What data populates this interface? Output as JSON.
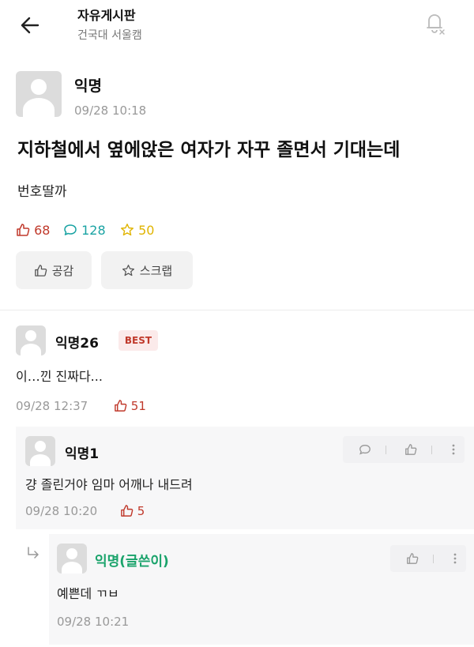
{
  "header": {
    "title": "자유게시판",
    "subtitle": "건국대 서울캠"
  },
  "post": {
    "author": "익명",
    "time": "09/28 10:18",
    "title": "지하철에서 옆에앉은 여자가 자꾸 졸면서 기대는데",
    "body": "번호딸까",
    "likes": "68",
    "comments": "128",
    "scraps": "50",
    "empathy_label": "공감",
    "scrap_label": "스크랩"
  },
  "comments": [
    {
      "author": "익명26",
      "badge": "BEST",
      "text": "이…낀 진짜다...",
      "time": "09/28 12:37",
      "likes": "51"
    },
    {
      "author": "익명1",
      "text": "걍 졸린거야 임마 어깨나 내드려",
      "time": "09/28 10:20",
      "likes": "5"
    },
    {
      "author": "익명(글쓴이)",
      "text": "예쁜데 ㄲㅂ",
      "time": "09/28 10:21"
    }
  ],
  "colors": {
    "like_red": "#c0392b",
    "comment_teal": "#1aa3a3",
    "scrap_gold": "#e0b400",
    "writer_green": "#1aa36b",
    "best_badge_bg": "#fbeaea"
  },
  "icons": [
    "back-arrow-icon",
    "bell-off-icon",
    "thumbs-up-icon",
    "speech-bubble-icon",
    "star-icon",
    "more-vertical-icon",
    "reply-arrow-icon"
  ]
}
